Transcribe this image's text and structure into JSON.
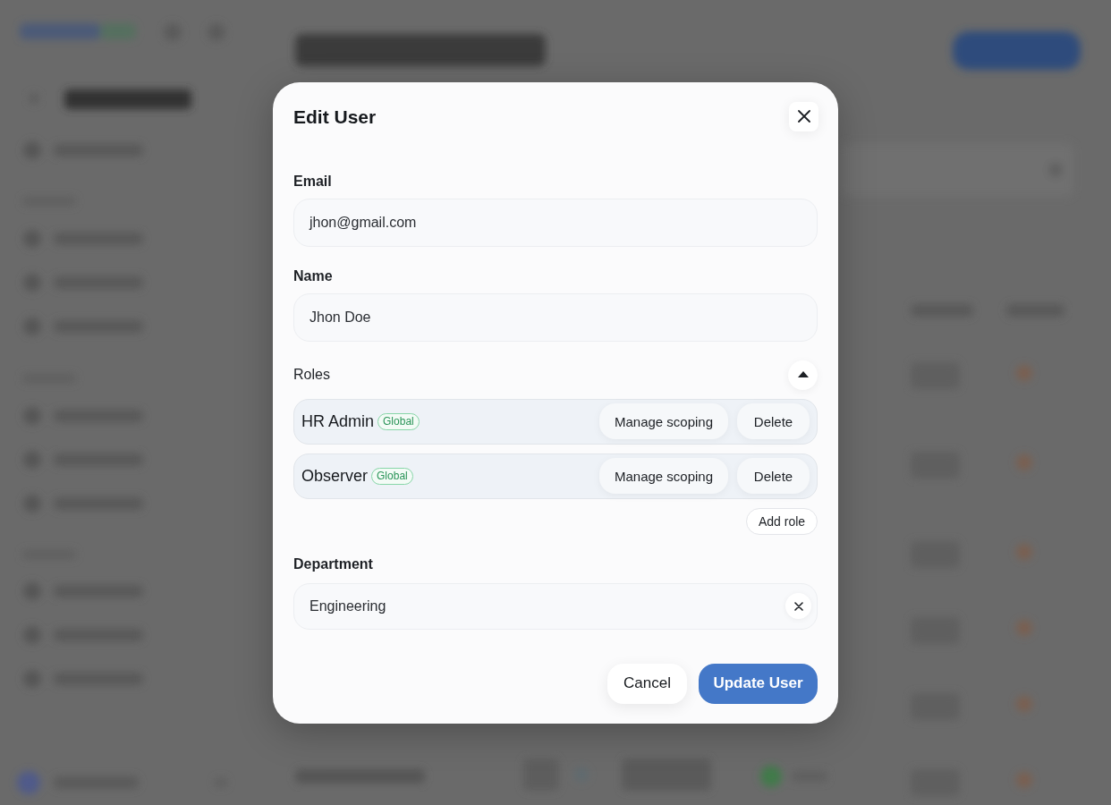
{
  "backdrop": {
    "blurred": true
  },
  "dialog": {
    "title": "Edit User",
    "fields": [
      {
        "label": "Email",
        "value": "jhon@gmail.com",
        "clearable": false
      },
      {
        "label": "Name",
        "value": "Jhon Doe",
        "clearable": false
      }
    ],
    "roles": {
      "label": "Roles",
      "expanded": true,
      "items": [
        {
          "name": "HR Admin",
          "scope": "Global",
          "actions": [
            "Manage scoping",
            "Delete"
          ]
        },
        {
          "name": "Observer",
          "scope": "Global",
          "actions": [
            "Manage scoping",
            "Delete"
          ]
        }
      ],
      "add_button": "Add role"
    },
    "department": {
      "label": "Department",
      "value": "Engineering",
      "clearable": true
    },
    "buttons": [
      {
        "label": "Cancel",
        "kind": "secondary"
      },
      {
        "label": "Update User",
        "kind": "primary"
      }
    ]
  }
}
